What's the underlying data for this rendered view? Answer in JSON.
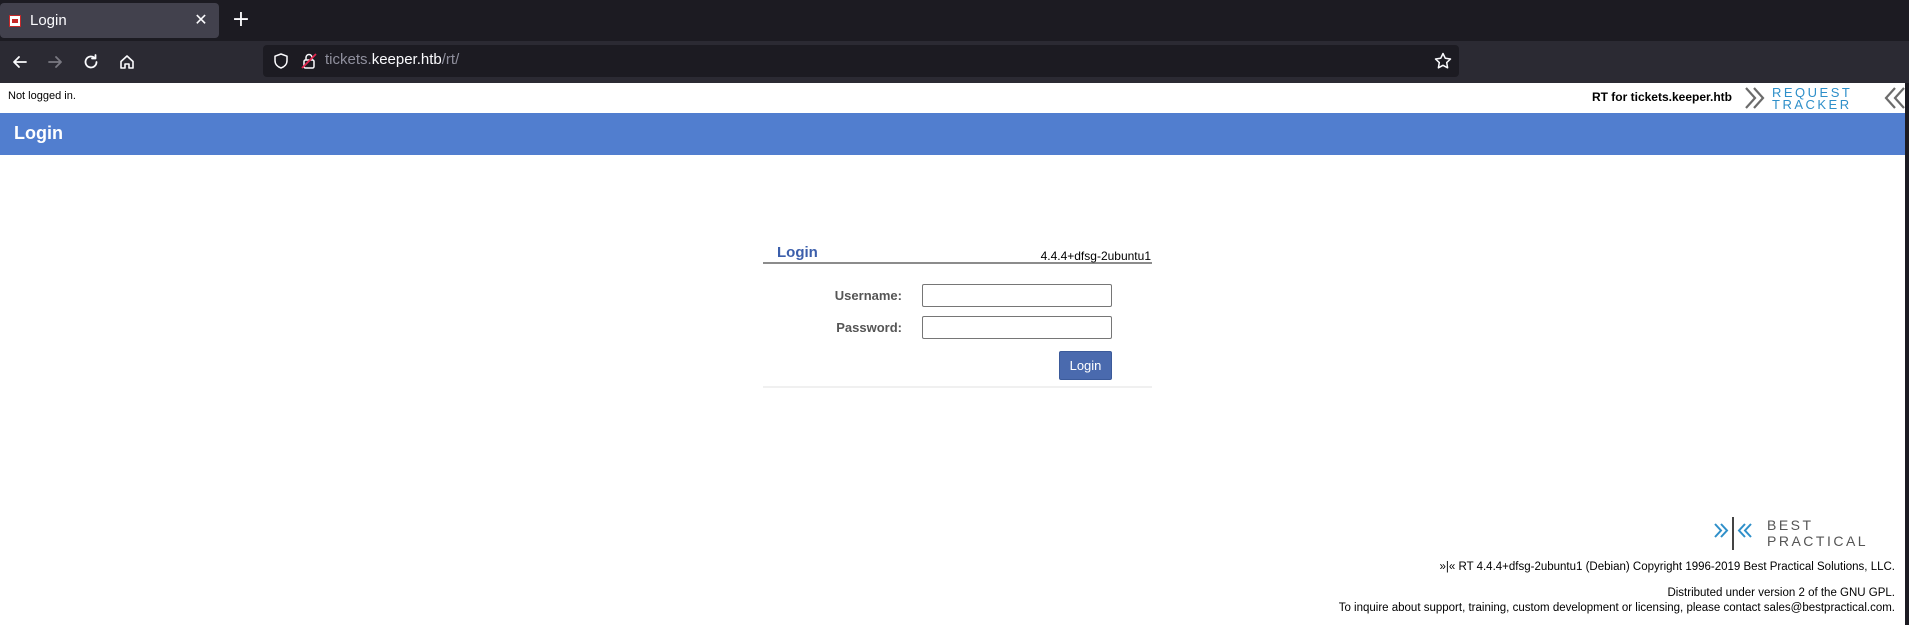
{
  "browser": {
    "tab_title": "Login",
    "tab_close_glyph": "✕",
    "new_tab_glyph": "+",
    "url_prefix": "tickets.",
    "url_host": "keeper.htb",
    "url_path": "/rt/"
  },
  "page": {
    "not_logged_in": "Not logged in.",
    "rt_for": "RT for tickets.keeper.htb",
    "rt_logo_top": "REQUEST",
    "rt_logo_bottom": "TRACKER",
    "header_title": "Login"
  },
  "login": {
    "title": "Login",
    "version": "4.4.4+dfsg-2ubuntu1",
    "username_label": "Username:",
    "password_label": "Password:",
    "username_value": "",
    "password_value": "",
    "button_label": "Login"
  },
  "footer": {
    "bp_logo_top": "BEST",
    "bp_logo_bottom": "PRACTICAL",
    "copyright": "»|« RT 4.4.4+dfsg-2ubuntu1 (Debian) Copyright 1996-2019 Best Practical Solutions, LLC.",
    "license": "Distributed under version 2 of the GNU GPL.",
    "contact": "To inquire about support, training, custom development or licensing, please contact sales@bestpractical.com."
  },
  "colors": {
    "header_blue": "#517ecf",
    "login_title_blue": "#3b5eab",
    "button_blue": "#4a6aae",
    "logo_blue": "#2e8fc9"
  }
}
